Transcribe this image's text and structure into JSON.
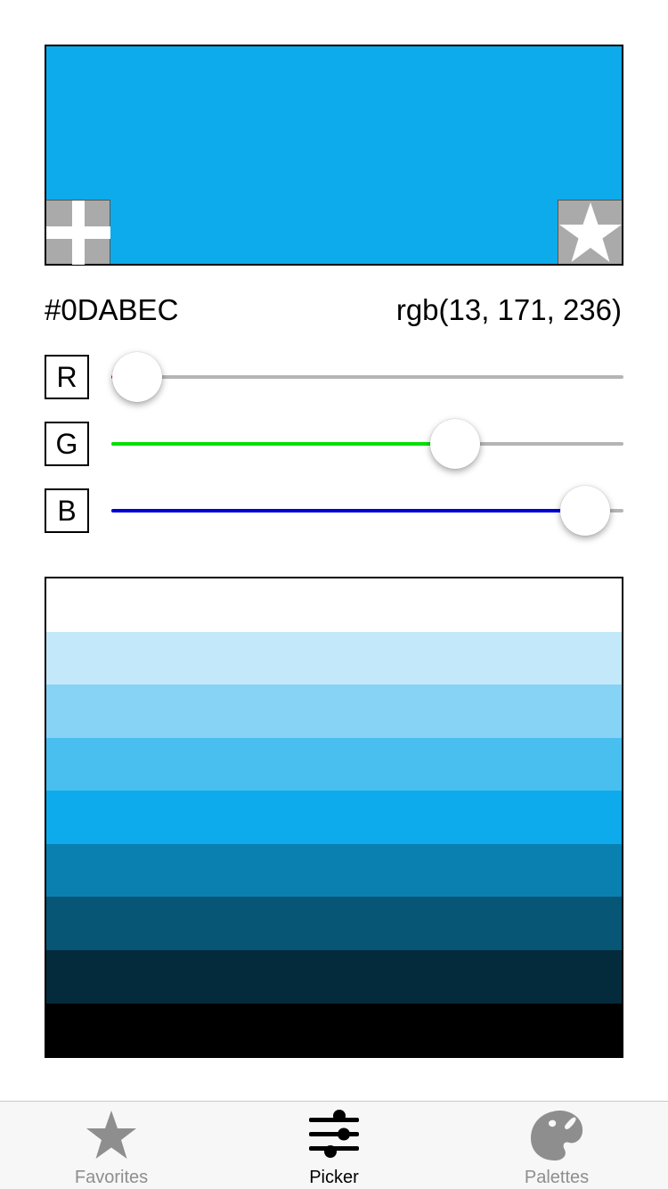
{
  "color": {
    "hex": "#0DABEC",
    "rgb_text": "rgb(13, 171, 236)",
    "r": 13,
    "g": 171,
    "b": 236
  },
  "channels": [
    {
      "label": "R",
      "value": 13,
      "max": 255,
      "fill_color": "#ff0000"
    },
    {
      "label": "G",
      "value": 171,
      "max": 255,
      "fill_color": "#00e000"
    },
    {
      "label": "B",
      "value": 236,
      "max": 255,
      "fill_color": "#0000d6"
    }
  ],
  "preview": {
    "add_icon": "plus-icon",
    "favorite_icon": "star-icon"
  },
  "shades": [
    "#FFFFFF",
    "#C3E8F9",
    "#86D3F5",
    "#49BFF0",
    "#0DABEC",
    "#0A80B1",
    "#075676",
    "#032B3B",
    "#000000"
  ],
  "tabbar": {
    "tabs": [
      {
        "label": "Favorites",
        "icon": "star-icon",
        "active": false
      },
      {
        "label": "Picker",
        "icon": "sliders-icon",
        "active": true
      },
      {
        "label": "Palettes",
        "icon": "palette-icon",
        "active": false
      }
    ],
    "active_color": "#000000",
    "inactive_color": "#8e8e8e"
  }
}
